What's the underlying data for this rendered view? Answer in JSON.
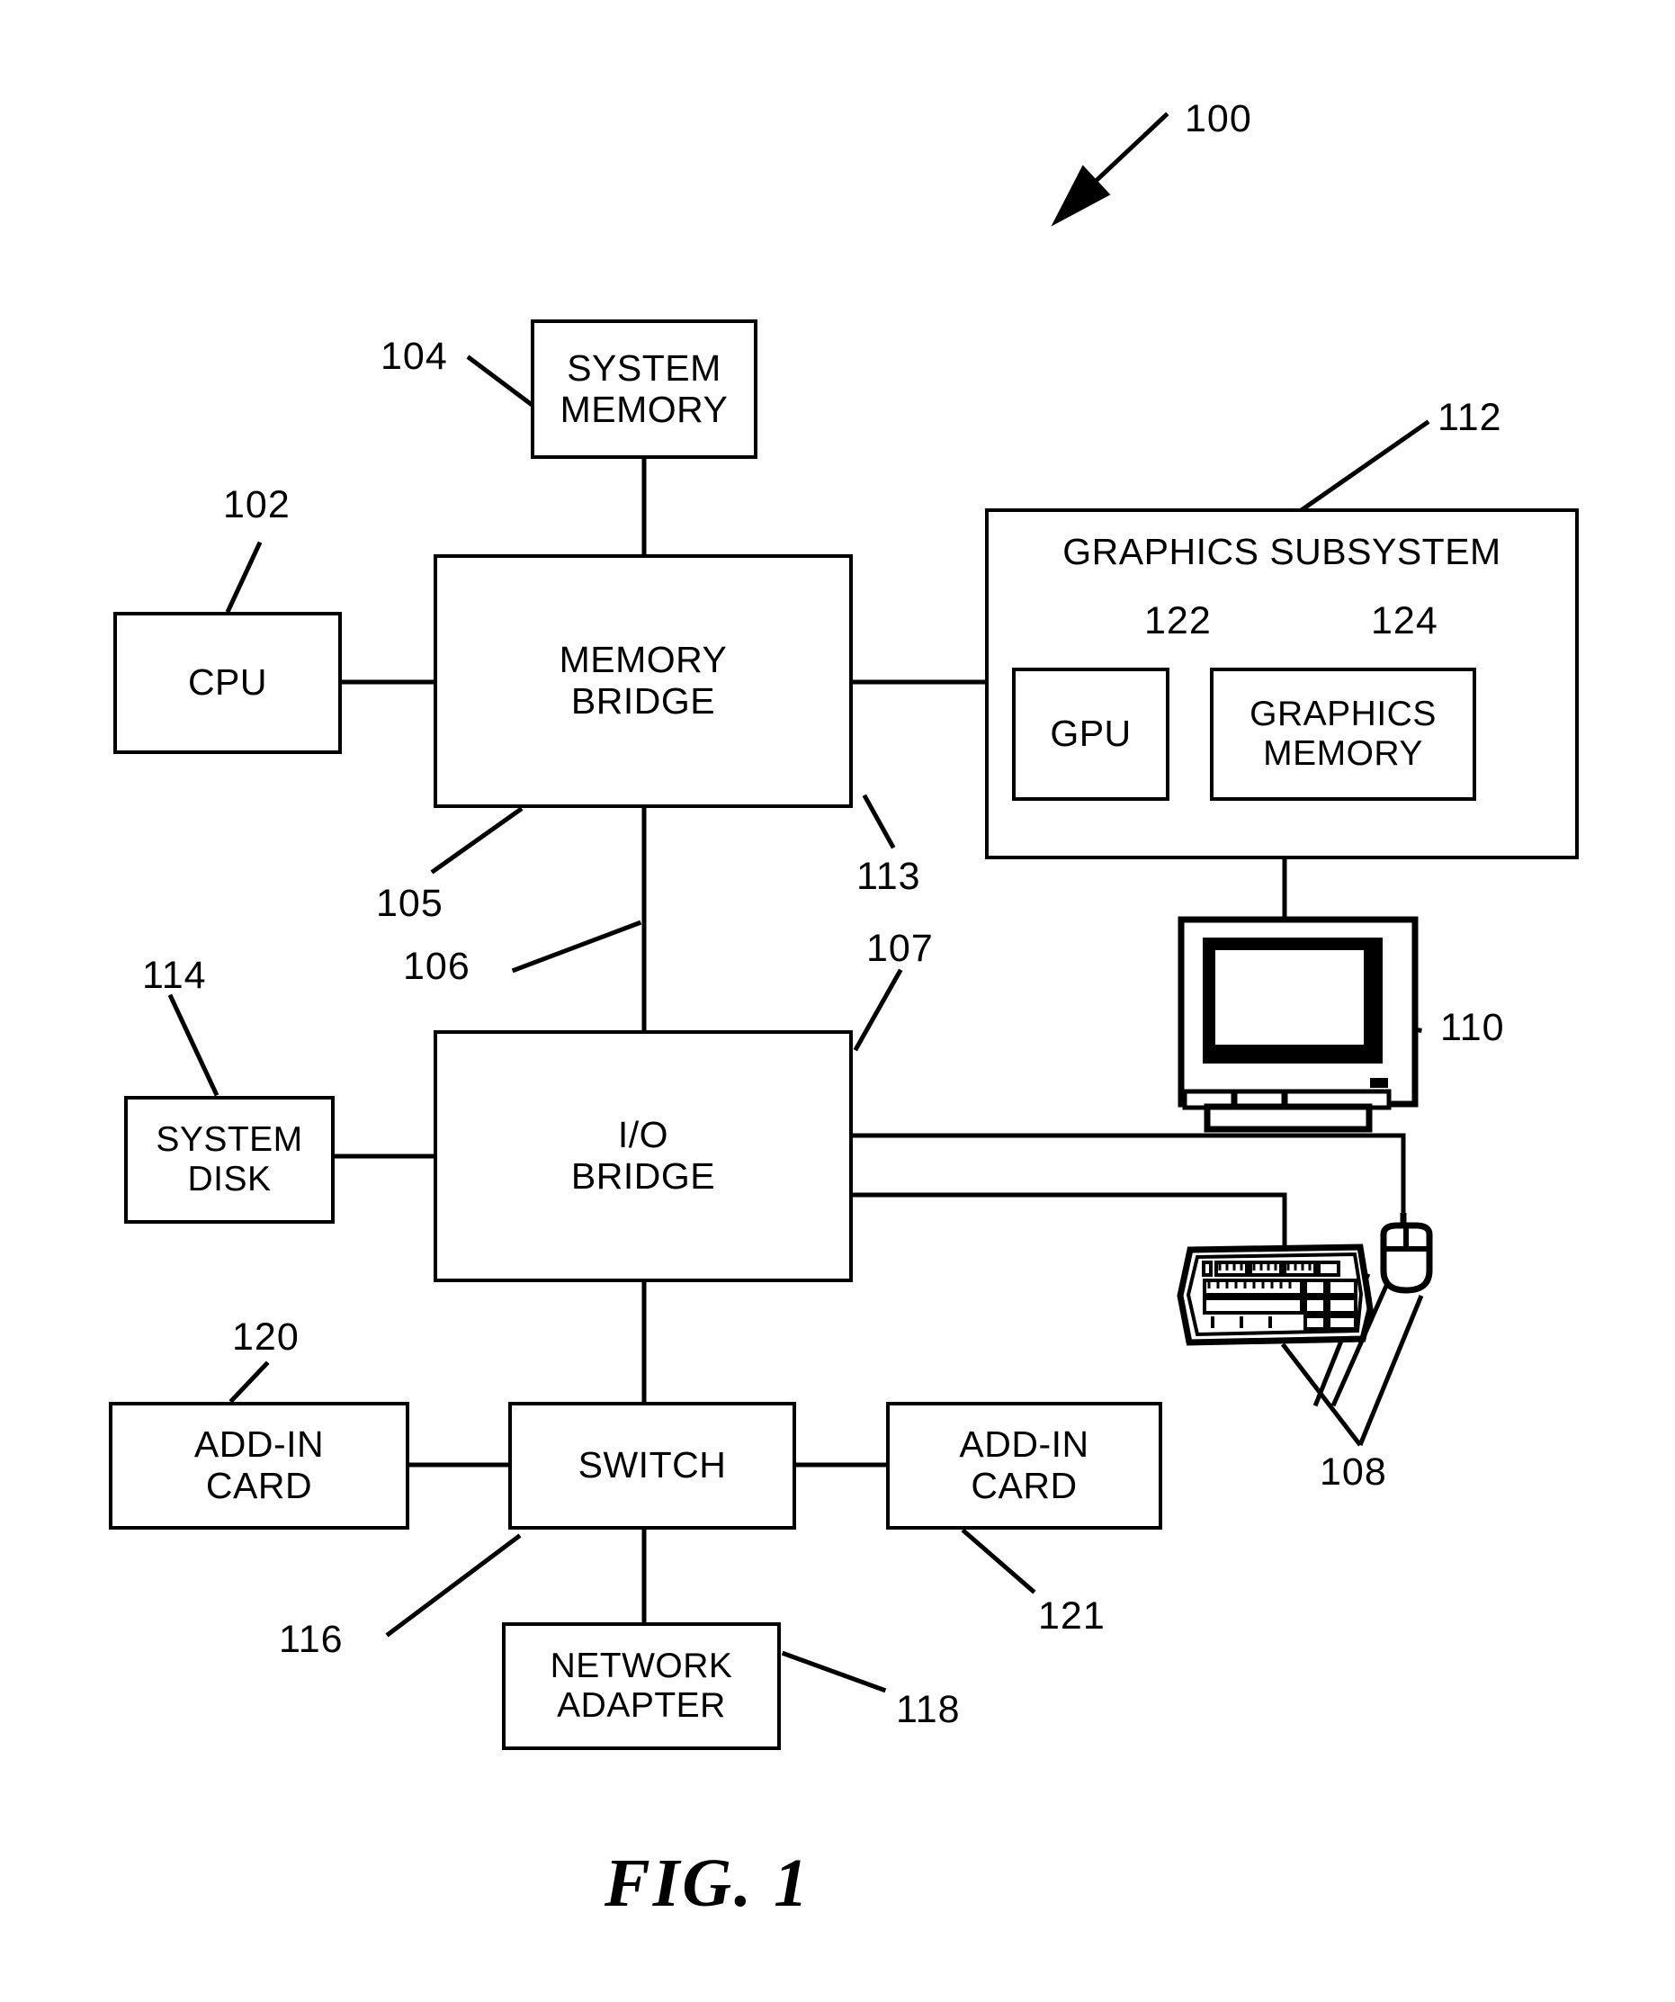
{
  "figure": {
    "caption": "FIG. 1",
    "system_ref": "100"
  },
  "blocks": {
    "cpu": {
      "label": "CPU",
      "ref": "102"
    },
    "system_memory": {
      "label": "SYSTEM\nMEMORY",
      "ref": "104"
    },
    "memory_bridge": {
      "label": "MEMORY\nBRIDGE",
      "ref": "105"
    },
    "graphics_subsystem": {
      "label": "GRAPHICS SUBSYSTEM",
      "ref": "112"
    },
    "gpu": {
      "label": "GPU",
      "ref": "122"
    },
    "graphics_memory": {
      "label": "GRAPHICS\nMEMORY",
      "ref": "124"
    },
    "display": {
      "label": "display-device",
      "ref": "110"
    },
    "io_bridge": {
      "label": "I/O\nBRIDGE",
      "ref": "107"
    },
    "system_disk": {
      "label": "SYSTEM\nDISK",
      "ref": "114"
    },
    "input_devices": {
      "label": "keyboard-and-mouse",
      "ref": "108"
    },
    "switch": {
      "label": "SWITCH",
      "ref": "116"
    },
    "add_in_card_left": {
      "label": "ADD-IN\nCARD",
      "ref": "120"
    },
    "add_in_card_right": {
      "label": "ADD-IN\nCARD",
      "ref": "121"
    },
    "network_adapter": {
      "label": "NETWORK\nADAPTER",
      "ref": "118"
    }
  },
  "connections": {
    "memory_bridge_to_io_bridge": {
      "ref": "106"
    },
    "memory_bridge_to_graphics": {
      "ref": "113"
    }
  },
  "colors": {
    "line": "#000000",
    "background": "#ffffff"
  }
}
